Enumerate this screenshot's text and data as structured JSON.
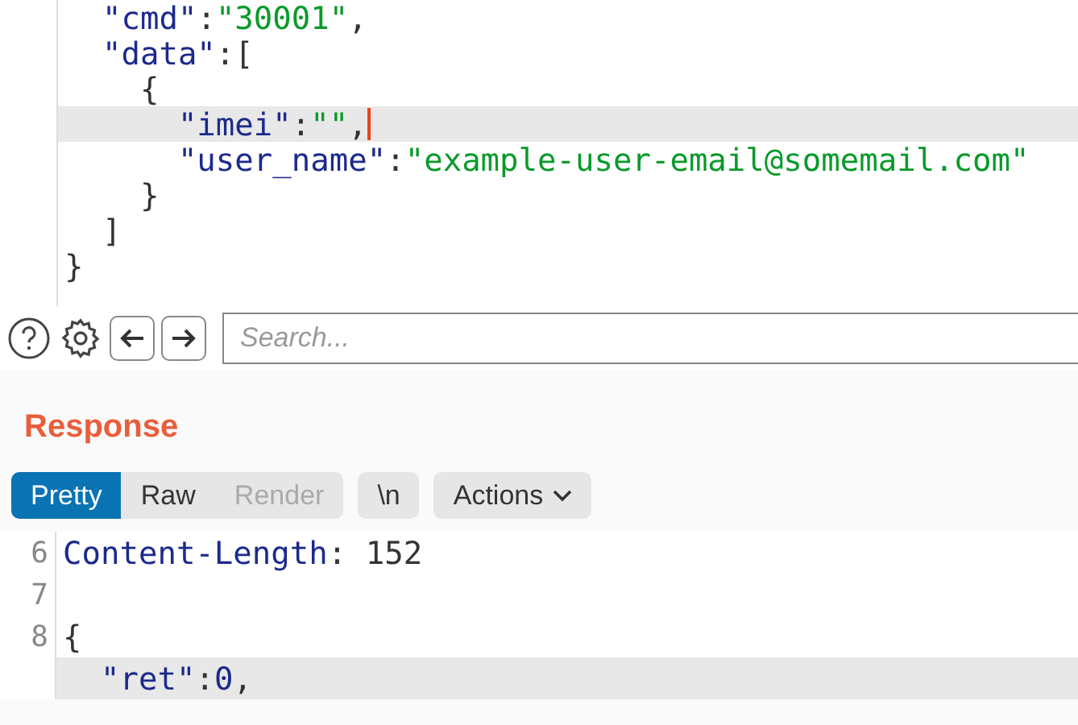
{
  "request_editor": {
    "lines": [
      {
        "highlighted": false,
        "caret": false,
        "tokens": [
          {
            "kind": "key",
            "text": "  \"cmd\""
          },
          {
            "kind": "plain",
            "text": ":"
          },
          {
            "kind": "string",
            "text": "\"30001\""
          },
          {
            "kind": "plain",
            "text": ","
          }
        ]
      },
      {
        "highlighted": false,
        "caret": false,
        "tokens": [
          {
            "kind": "key",
            "text": "  \"data\""
          },
          {
            "kind": "plain",
            "text": ":["
          }
        ]
      },
      {
        "highlighted": false,
        "caret": false,
        "tokens": [
          {
            "kind": "plain",
            "text": "    {"
          }
        ]
      },
      {
        "highlighted": true,
        "caret": true,
        "tokens": [
          {
            "kind": "key",
            "text": "      \"imei\""
          },
          {
            "kind": "plain",
            "text": ":"
          },
          {
            "kind": "string",
            "text": "\"\""
          },
          {
            "kind": "plain",
            "text": ","
          }
        ]
      },
      {
        "highlighted": false,
        "caret": false,
        "tokens": [
          {
            "kind": "key",
            "text": "      \"user_name\""
          },
          {
            "kind": "plain",
            "text": ":"
          },
          {
            "kind": "string",
            "text": "\"example-user-email@somemail.com\""
          }
        ]
      },
      {
        "highlighted": false,
        "caret": false,
        "tokens": [
          {
            "kind": "plain",
            "text": "    }"
          }
        ]
      },
      {
        "highlighted": false,
        "caret": false,
        "tokens": [
          {
            "kind": "plain",
            "text": "  ]"
          }
        ]
      },
      {
        "highlighted": false,
        "caret": false,
        "tokens": [
          {
            "kind": "plain",
            "text": "}"
          }
        ]
      }
    ]
  },
  "search": {
    "placeholder": "Search..."
  },
  "response": {
    "title": "Response",
    "view_tabs": [
      {
        "label": "Pretty",
        "selected": true,
        "disabled": false
      },
      {
        "label": "Raw",
        "selected": false,
        "disabled": false
      },
      {
        "label": "Render",
        "selected": false,
        "disabled": true
      }
    ],
    "newline_button": "\\n",
    "actions_button": "Actions",
    "lines": [
      {
        "number": "6",
        "highlighted": false,
        "tokens": [
          {
            "kind": "key",
            "text": "Content-Length"
          },
          {
            "kind": "plain",
            "text": ": 152"
          }
        ]
      },
      {
        "number": "7",
        "highlighted": false
      },
      {
        "number": "8",
        "highlighted": false,
        "tokens": [
          {
            "kind": "plain",
            "text": "{"
          }
        ]
      },
      {
        "highlighted": true,
        "tokens": [
          {
            "kind": "key",
            "text": "  \"ret\""
          },
          {
            "kind": "plain",
            "text": ":"
          },
          {
            "kind": "number",
            "text": "0"
          },
          {
            "kind": "plain",
            "text": ","
          }
        ]
      }
    ]
  }
}
